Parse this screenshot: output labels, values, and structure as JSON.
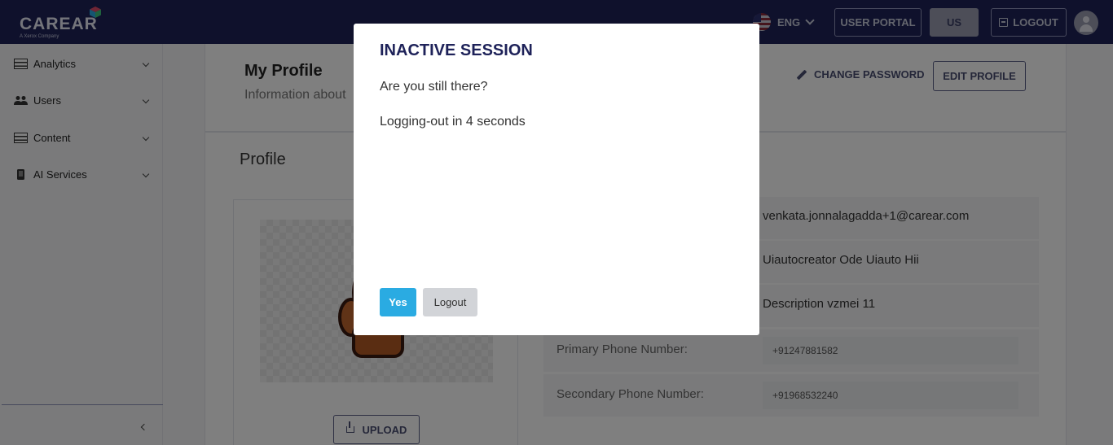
{
  "brand": {
    "logo_text": "CAREAR",
    "logo_sub": "A Xerox Company"
  },
  "topbar": {
    "language": "ENG",
    "user_portal_label": "USER PORTAL",
    "region_label": "US",
    "logout_label": "LOGOUT"
  },
  "sidebar": {
    "items": [
      {
        "label": "Analytics",
        "icon": "table-icon"
      },
      {
        "label": "Users",
        "icon": "users-icon"
      },
      {
        "label": "Content",
        "icon": "table-icon"
      },
      {
        "label": "AI Services",
        "icon": "device-icon"
      }
    ]
  },
  "header": {
    "title": "My Profile",
    "subtitle": "Information about",
    "change_password_label": "CHANGE PASSWORD",
    "edit_profile_label": "EDIT PROFILE"
  },
  "profile": {
    "section_title": "Profile",
    "upload_label": "UPLOAD",
    "fields": [
      {
        "label": "",
        "value": "venkata.jonnalagadda+1@carear.com"
      },
      {
        "label": "",
        "value": "Uiautocreator Ode Uiauto Hii"
      },
      {
        "label": "",
        "value": "Description vzmei 11"
      },
      {
        "label": "Primary Phone Number:",
        "value": "+91247881582"
      },
      {
        "label": "Secondary Phone Number:",
        "value": "+91968532240"
      }
    ]
  },
  "modal": {
    "title": "INACTIVE SESSION",
    "question": "Are you still there?",
    "countdown": "Logging-out in 4 seconds",
    "yes_label": "Yes",
    "logout_label": "Logout"
  },
  "colors": {
    "topbar": "#1e2259",
    "accent": "#2aabe2"
  }
}
